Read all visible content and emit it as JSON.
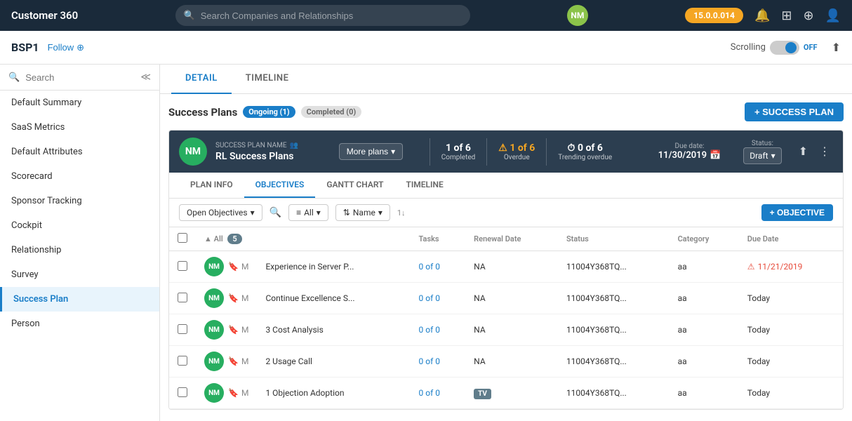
{
  "app": {
    "title": "Customer 360",
    "version": "15.0.0.014",
    "search_placeholder": "Search Companies and Relationships"
  },
  "subheader": {
    "company": "BSP1",
    "follow": "Follow",
    "scrolling_label": "Scrolling",
    "scrolling_state": "OFF"
  },
  "tabs": {
    "detail": "DETAIL",
    "timeline": "TIMELINE"
  },
  "sidebar": {
    "search_placeholder": "Search",
    "items": [
      {
        "id": "default-summary",
        "label": "Default Summary"
      },
      {
        "id": "saas-metrics",
        "label": "SaaS Metrics"
      },
      {
        "id": "default-attributes",
        "label": "Default Attributes"
      },
      {
        "id": "scorecard",
        "label": "Scorecard"
      },
      {
        "id": "sponsor-tracking",
        "label": "Sponsor Tracking"
      },
      {
        "id": "cockpit",
        "label": "Cockpit"
      },
      {
        "id": "relationship",
        "label": "Relationship"
      },
      {
        "id": "survey",
        "label": "Survey"
      },
      {
        "id": "success-plan",
        "label": "Success Plan",
        "active": true
      },
      {
        "id": "person",
        "label": "Person"
      }
    ]
  },
  "plans": {
    "title": "Success Plans",
    "badge_ongoing": "Ongoing (1)",
    "badge_completed": "Completed (0)",
    "btn_add": "+ SUCCESS PLAN",
    "plan": {
      "name_label": "SUCCESS PLAN NAME",
      "name": "RL Success Plans",
      "more_plans": "More plans",
      "stats": {
        "completed": {
          "number": "1 of 6",
          "label": "Completed"
        },
        "overdue": {
          "number": "1 of 6",
          "label": "Overdue",
          "icon": "⚠"
        },
        "trending_overdue": {
          "number": "0 of 6",
          "label": "Trending overdue",
          "icon": "⏱"
        }
      },
      "due_date_label": "Due date:",
      "due_date": "11/30/2019",
      "status_label": "Status:",
      "status": "Draft"
    }
  },
  "plan_tabs": {
    "plan_info": "PLAN INFO",
    "objectives": "OBJECTIVES",
    "gantt_chart": "GANTT CHART",
    "timeline": "TIMELINE"
  },
  "objectives": {
    "filter": "Open Objectives",
    "group_filter": "All",
    "sort": "Name",
    "btn_add": "+ OBJECTIVE",
    "table": {
      "headers": {
        "name": "",
        "tasks": "Tasks",
        "renewal_date": "Renewal Date",
        "status": "Status",
        "category": "Category",
        "due_date": "Due Date"
      },
      "all_count": "5",
      "rows": [
        {
          "id": 1,
          "name": "Experience in Server P...",
          "tasks": "0 of 0",
          "renewal_date": "NA",
          "status": "11004Y368TQ...",
          "category": "aa",
          "due_date": "11/21/2019",
          "overdue": true
        },
        {
          "id": 2,
          "name": "Continue Excellence S...",
          "tasks": "0 of 0",
          "renewal_date": "NA",
          "status": "11004Y368TQ...",
          "category": "aa",
          "due_date": "Today",
          "overdue": false
        },
        {
          "id": 3,
          "name": "3 Cost Analysis",
          "tasks": "0 of 0",
          "renewal_date": "NA",
          "status": "11004Y368TQ...",
          "category": "aa",
          "due_date": "Today",
          "overdue": false
        },
        {
          "id": 4,
          "name": "2 Usage Call",
          "tasks": "0 of 0",
          "renewal_date": "NA",
          "status": "11004Y368TQ...",
          "category": "aa",
          "due_date": "Today",
          "overdue": false
        },
        {
          "id": 5,
          "name": "1 Objection Adoption",
          "tasks": "0 of 0",
          "renewal_date": "TV",
          "status": "11004Y368TQ...",
          "category": "aa",
          "due_date": "Today",
          "overdue": false,
          "tv_badge": true
        }
      ]
    }
  }
}
